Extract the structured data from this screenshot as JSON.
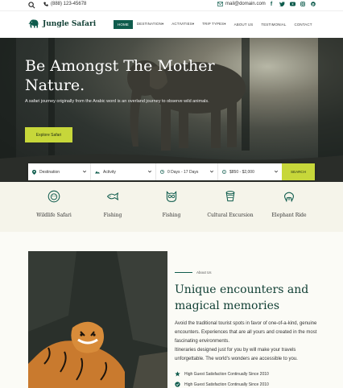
{
  "topbar": {
    "phone": "(888) 123-45678",
    "email": "mail@domain.com",
    "social": [
      "f",
      "t",
      "yt",
      "ig",
      "p"
    ]
  },
  "header": {
    "brand": "Jungle Safari",
    "nav": [
      "HOME",
      "DESTINATION",
      "ACTIVITIES",
      "TRIP TYPES",
      "ABOUT US",
      "TESTIMONIAL",
      "CONTACT"
    ],
    "nav_dropdown": [
      "DESTINATION",
      "ACTIVITIES",
      "TRIP TYPES"
    ]
  },
  "hero": {
    "title": "Be Amongst The Mother Nature.",
    "description": "A safari journey originally from the Arabic word is an overland journey to observe wild animals.",
    "cta": "Explore Safari"
  },
  "search": {
    "destination": "Destination",
    "activity": "Activity",
    "duration": "0 Days - 17 Days",
    "price": "$850 - $2,000",
    "button": "SEARCH"
  },
  "activities": [
    {
      "label": "Wildlife Safari",
      "icon": "lion-icon"
    },
    {
      "label": "Fishing",
      "icon": "fish-icon"
    },
    {
      "label": "Fishing",
      "icon": "owl-icon"
    },
    {
      "label": "Cultural Excursion",
      "icon": "drum-icon"
    },
    {
      "label": "Elephant Ride",
      "icon": "elephant-icon"
    }
  ],
  "about": {
    "kicker": "About Us",
    "title": "Unique encounters and magical memories",
    "para1": "Avoid the traditional tourist spots in favor of one-of-a-kind, genuine encounters. Experiences that are all yours and created in the most fascinating environments.",
    "para2": "Itineraries designed just for you by will make your travels unforgettable. The world's wonders are accessible to you.",
    "features": [
      "High Guest Satisfaction Continually Since 2010",
      "High Guest Satisfaction Continually Since 2010"
    ]
  },
  "colors": {
    "brand": "#0f5c4d",
    "accent": "#c7d73a",
    "strip": "#f5f4ea"
  }
}
